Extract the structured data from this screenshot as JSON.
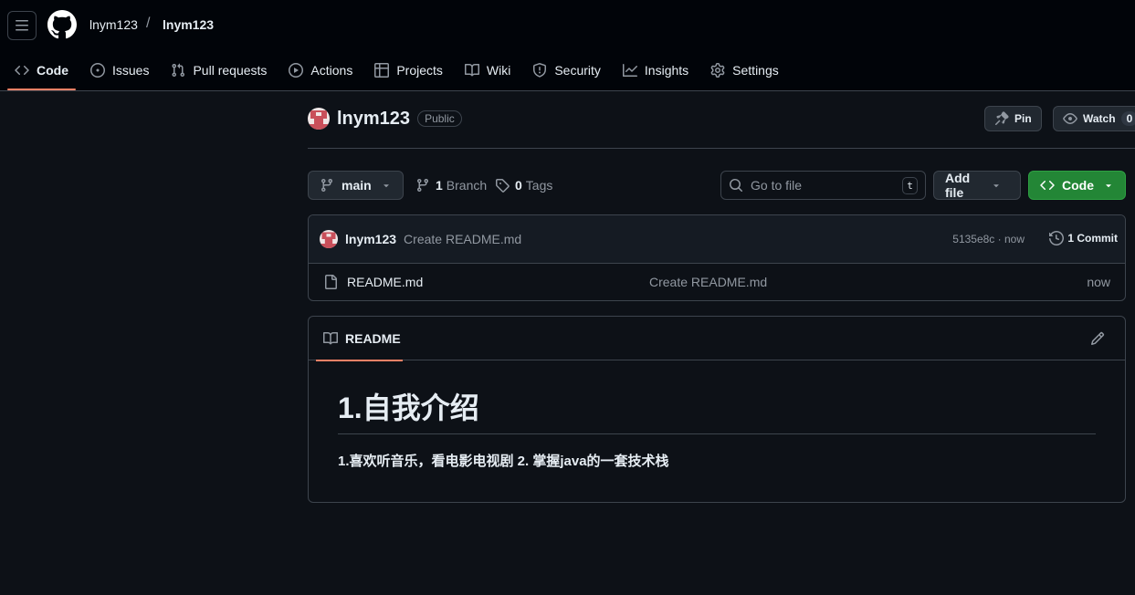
{
  "header": {
    "owner": "lnym123",
    "separator": "/",
    "repo": "lnym123"
  },
  "tabs": [
    {
      "label": "Code",
      "icon": "code-icon",
      "active": true
    },
    {
      "label": "Issues",
      "icon": "issue-icon"
    },
    {
      "label": "Pull requests",
      "icon": "pull-request-icon"
    },
    {
      "label": "Actions",
      "icon": "play-icon"
    },
    {
      "label": "Projects",
      "icon": "table-icon"
    },
    {
      "label": "Wiki",
      "icon": "book-icon"
    },
    {
      "label": "Security",
      "icon": "shield-icon"
    },
    {
      "label": "Insights",
      "icon": "graph-icon"
    },
    {
      "label": "Settings",
      "icon": "gear-icon"
    }
  ],
  "repo": {
    "name": "lnym123",
    "visibility": "Public",
    "pin_label": "Pin",
    "watch_label": "Watch",
    "watch_count": "0"
  },
  "branch_bar": {
    "branch": "main",
    "branch_count": "1",
    "branch_label": "Branch",
    "tag_count": "0",
    "tag_label": "Tags",
    "search_placeholder": "Go to file",
    "search_kbd": "t",
    "add_file_label": "Add file",
    "code_label": "Code"
  },
  "commit": {
    "author": "lnym123",
    "message": "Create README.md",
    "sha_time": "5135e8c · now",
    "count_label": "1 Commit"
  },
  "files": [
    {
      "name": "README.md",
      "message": "Create README.md",
      "time": "now"
    }
  ],
  "readme": {
    "tab_label": "README",
    "heading": "1.自我介绍",
    "paragraph": "1.喜欢听音乐，看电影电视剧 2. 掌握java的一套技术栈"
  },
  "colors": {
    "accent_underline": "#f78166",
    "code_button": "#238636",
    "background": "#0d1117",
    "header_background": "#010409"
  }
}
